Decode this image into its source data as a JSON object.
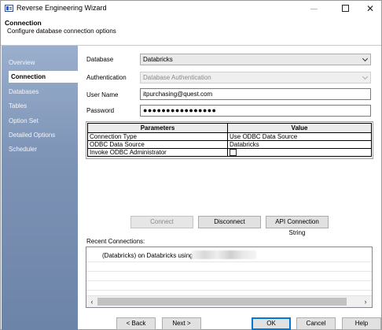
{
  "window": {
    "title": "Reverse Engineering Wizard"
  },
  "header": {
    "title": "Connection",
    "subtitle": "Configure database connection options"
  },
  "sidebar": {
    "items": [
      {
        "label": "Overview",
        "active": false
      },
      {
        "label": "Connection",
        "active": true
      },
      {
        "label": "Databases",
        "active": false
      },
      {
        "label": "Tables",
        "active": false
      },
      {
        "label": "Option Set",
        "active": false
      },
      {
        "label": "Detailed Options",
        "active": false
      },
      {
        "label": "Scheduler",
        "active": false
      }
    ]
  },
  "form": {
    "database_label": "Database",
    "database_value": "Databricks",
    "auth_label": "Authentication",
    "auth_value": "Database Authentication",
    "username_label": "User Name",
    "username_value": "itpurchasing@quest.com",
    "password_label": "Password",
    "password_value": "●●●●●●●●●●●●●●●●"
  },
  "parameters": {
    "headers": [
      "Parameters",
      "Value"
    ],
    "rows": [
      {
        "name": "Connection Type",
        "value": "Use ODBC Data Source"
      },
      {
        "name": "ODBC Data Source",
        "value": "Databricks"
      },
      {
        "name": "Invoke ODBC Administrator",
        "value": "",
        "checkbox": true,
        "checked": false
      }
    ]
  },
  "connection_buttons": {
    "connect": "Connect",
    "disconnect": "Disconnect",
    "api_string": "API Connection String"
  },
  "recent": {
    "label": "Recent Connections:",
    "items": [
      "(Databricks) on Databricks using"
    ]
  },
  "footer": {
    "back": "< Back",
    "next": "Next >",
    "ok": "OK",
    "cancel": "Cancel",
    "help": "Help"
  },
  "icons": {
    "app": "wizard-app-icon",
    "minimize": "minimize-icon",
    "maximize": "maximize-icon",
    "close": "close-icon",
    "dropdown": "chevron-down-icon",
    "scroll_left": "scroll-left-arrow-icon",
    "scroll_right": "scroll-right-arrow-icon"
  }
}
